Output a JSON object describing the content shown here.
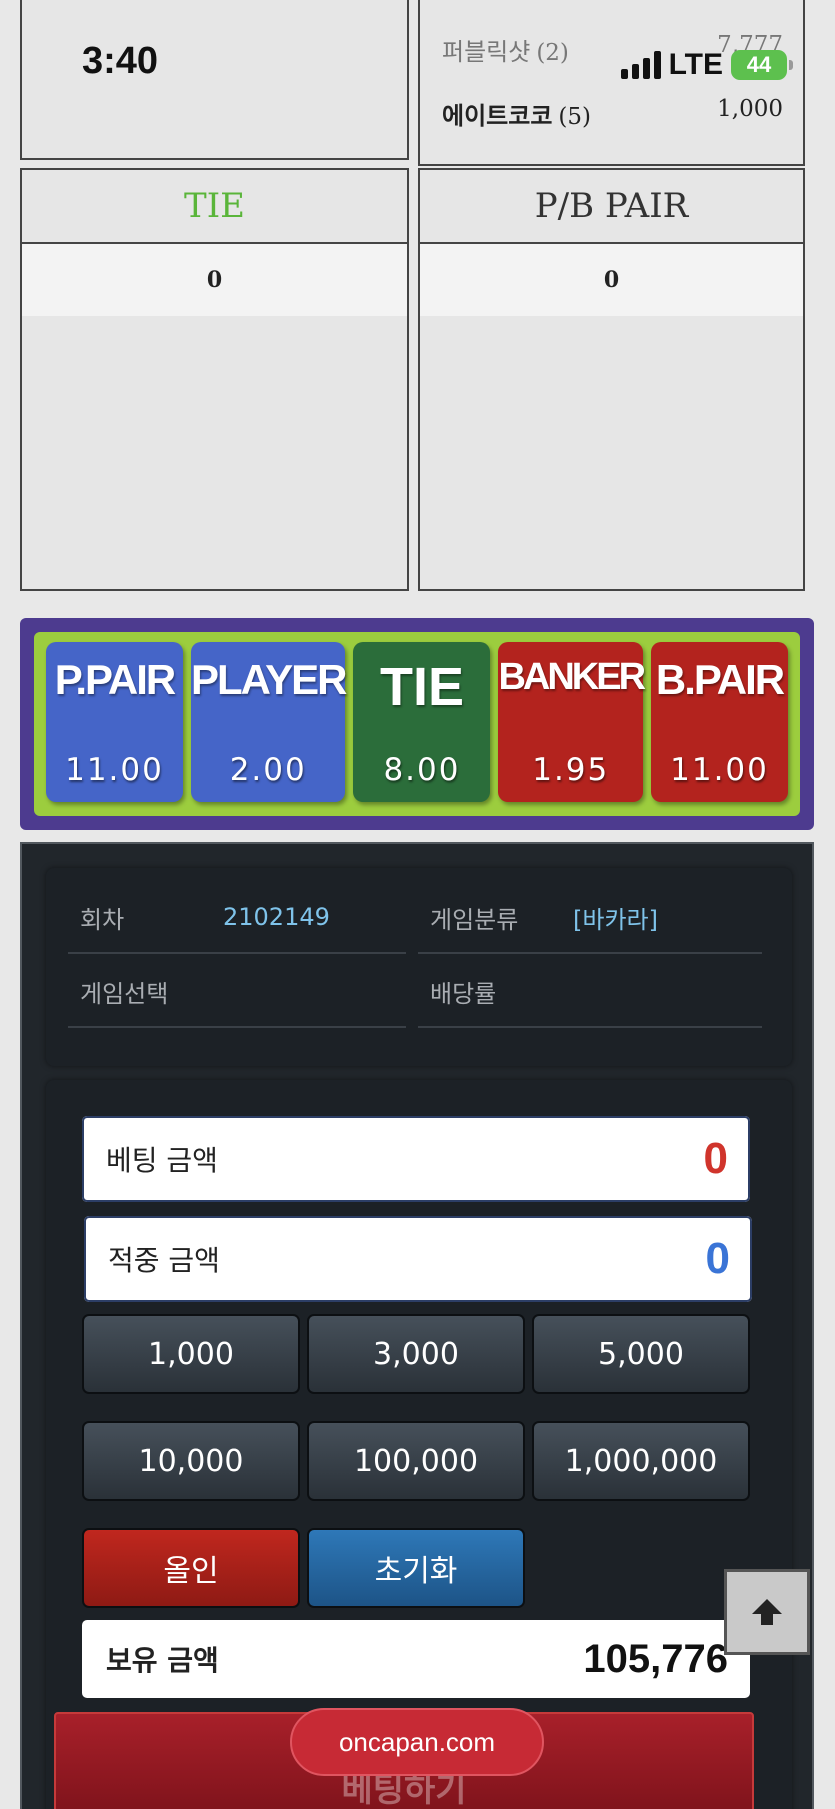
{
  "status_bar": {
    "time": "3:40",
    "network": "LTE",
    "battery": "44"
  },
  "ranking": [
    {
      "name": "퍼블릭샷",
      "count": "(2)",
      "amount": "7,777"
    },
    {
      "name": "에이트코코",
      "count": "(5)",
      "amount": "1,000"
    }
  ],
  "stat_panels": {
    "tie": {
      "title": "TIE",
      "value": "0"
    },
    "pb_pair": {
      "title": "P/B PAIR",
      "value": "0"
    }
  },
  "bet_options": [
    {
      "label": "P.PAIR",
      "odds": "11.00",
      "color": "#4565c8"
    },
    {
      "label": "PLAYER",
      "odds": "2.00",
      "color": "#4565c8"
    },
    {
      "label": "TIE",
      "odds": "8.00",
      "color": "#2b6d3a"
    },
    {
      "label": "BANKER",
      "odds": "1.95",
      "color": "#b3231e"
    },
    {
      "label": "B.PAIR",
      "odds": "11.00",
      "color": "#b3231e"
    }
  ],
  "game_info": {
    "round_label": "회차",
    "round_value": "2102149",
    "category_label": "게임분류",
    "category_value": "[바카라]",
    "selection_label": "게임선택",
    "selection_value": "",
    "odds_label": "배당률",
    "odds_value": ""
  },
  "betting": {
    "bet_amount_label": "베팅 금액",
    "bet_amount_value": "0",
    "win_amount_label": "적중 금액",
    "win_amount_value": "0",
    "chips": [
      "1,000",
      "3,000",
      "5,000",
      "10,000",
      "100,000",
      "1,000,000"
    ],
    "allin_label": "올인",
    "reset_label": "초기화",
    "balance_label": "보유 금액",
    "balance_value": "105,776",
    "submit_label": "베팅하기"
  },
  "watermark": "oncapan.com",
  "icons": {
    "scroll_top": "arrow-up-icon",
    "signal": "signal-icon",
    "battery": "battery-icon"
  }
}
